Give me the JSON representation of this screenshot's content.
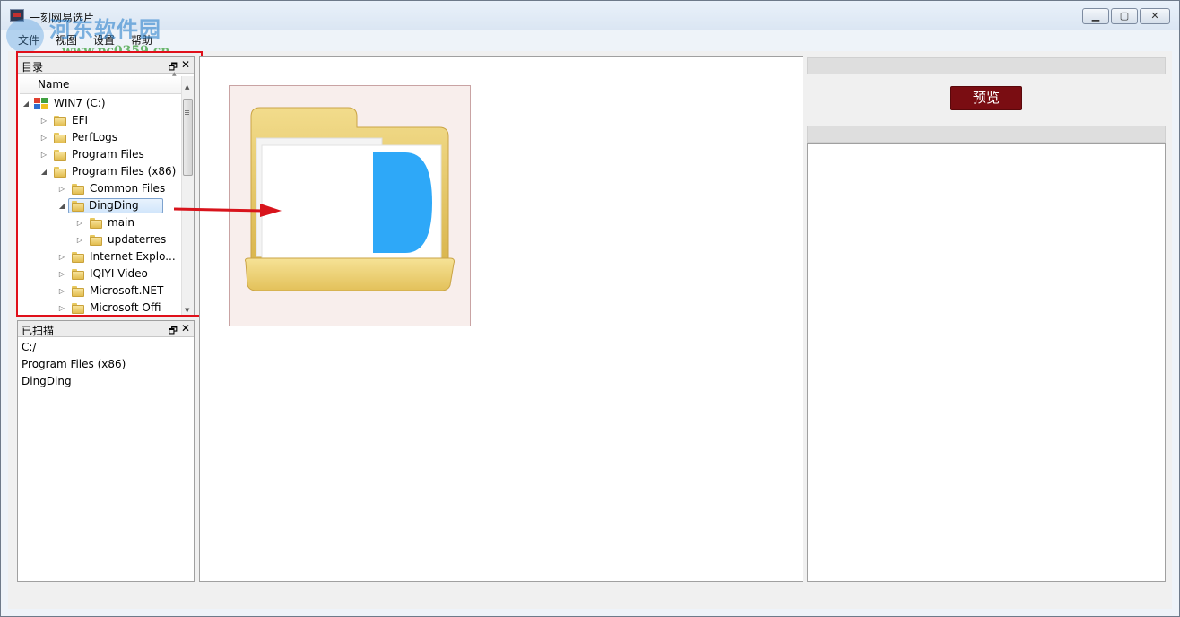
{
  "window": {
    "title": "一刻网易选片",
    "controls": {
      "minimize": "▁",
      "maximize": "▢",
      "close": "✕"
    }
  },
  "watermark": {
    "site_name": "河东软件园",
    "url": "www.pc0359.cn"
  },
  "menubar": {
    "items": [
      "文件",
      "视图",
      "设置",
      "帮助"
    ]
  },
  "directory_panel": {
    "title": "目录",
    "column_header": "Name",
    "tree": [
      {
        "label": "WIN7 (C:)",
        "level": 0,
        "expanded": true,
        "type": "drive"
      },
      {
        "label": "EFI",
        "level": 1,
        "expanded": false,
        "type": "folder"
      },
      {
        "label": "PerfLogs",
        "level": 1,
        "expanded": false,
        "type": "folder"
      },
      {
        "label": "Program Files",
        "level": 1,
        "expanded": false,
        "type": "folder"
      },
      {
        "label": "Program Files (x86)",
        "level": 1,
        "expanded": true,
        "type": "folder"
      },
      {
        "label": "Common Files",
        "level": 2,
        "expanded": false,
        "type": "folder"
      },
      {
        "label": "DingDing",
        "level": 2,
        "expanded": true,
        "type": "folder",
        "selected": true
      },
      {
        "label": "main",
        "level": 3,
        "expanded": false,
        "type": "folder"
      },
      {
        "label": "updaterres",
        "level": 3,
        "expanded": false,
        "type": "folder"
      },
      {
        "label": "Internet Explo...",
        "level": 2,
        "expanded": false,
        "type": "folder"
      },
      {
        "label": "IQIYI Video",
        "level": 2,
        "expanded": false,
        "type": "folder"
      },
      {
        "label": "Microsoft.NET",
        "level": 2,
        "expanded": false,
        "type": "folder"
      },
      {
        "label": "Microsoft Offi",
        "level": 2,
        "expanded": false,
        "type": "folder"
      }
    ]
  },
  "scanned_panel": {
    "title": "已扫描",
    "items": [
      "C:/",
      "Program Files (x86)",
      "DingDing"
    ]
  },
  "preview": {
    "button_label": "预览"
  },
  "colors": {
    "highlight_red": "#e0101a",
    "preview_button": "#7a0d12",
    "folder_yellow": "#e7c85e",
    "folder_blue": "#2ea8f8"
  }
}
